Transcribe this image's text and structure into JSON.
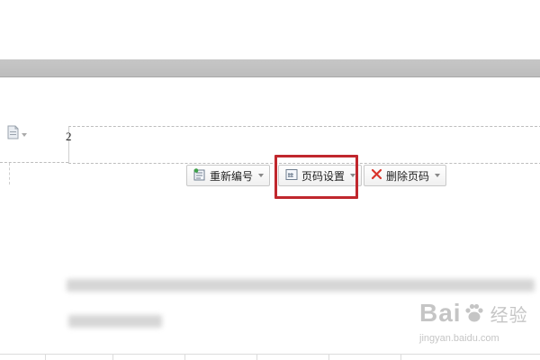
{
  "header_area": {
    "page_number": "2",
    "doc_icon": "document-icon"
  },
  "toolbar": {
    "buttons": [
      {
        "label": "重新编号",
        "icon": "renumber-icon",
        "has_dropdown": true
      },
      {
        "label": "页码设置",
        "icon": "page-number-settings-icon",
        "has_dropdown": true,
        "highlighted": true
      },
      {
        "label": "删除页码",
        "icon": "close-icon",
        "has_dropdown": true
      }
    ]
  },
  "watermark": {
    "top": "Bai",
    "top_tail": "经验",
    "bottom": "jingyan.baidu.com"
  },
  "colors": {
    "highlight": "#c0272d",
    "delete_icon": "#d9342b",
    "gray_band": "#c3c3c3"
  }
}
